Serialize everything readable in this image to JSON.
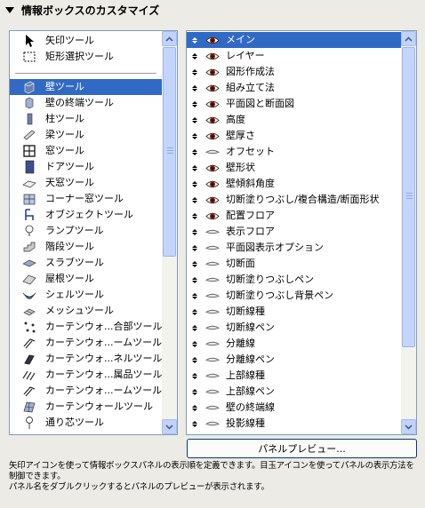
{
  "header": {
    "title": "情報ボックスのカスタマイズ"
  },
  "tools": {
    "top_items": [
      {
        "label": "矢印ツール",
        "icon": "arrow-cursor-icon"
      },
      {
        "label": "矩形選択ツール",
        "icon": "marquee-select-icon"
      }
    ],
    "items": [
      {
        "label": "壁ツール",
        "icon": "wall-icon",
        "selected": true
      },
      {
        "label": "壁の終端ツール",
        "icon": "wall-end-icon"
      },
      {
        "label": "柱ツール",
        "icon": "column-icon"
      },
      {
        "label": "梁ツール",
        "icon": "beam-icon"
      },
      {
        "label": "窓ツール",
        "icon": "window-icon"
      },
      {
        "label": "ドアツール",
        "icon": "door-icon"
      },
      {
        "label": "天窓ツール",
        "icon": "skylight-icon"
      },
      {
        "label": "コーナー窓ツール",
        "icon": "corner-window-icon"
      },
      {
        "label": "オブジェクトツール",
        "icon": "object-chair-icon"
      },
      {
        "label": "ランプツール",
        "icon": "lamp-icon"
      },
      {
        "label": "階段ツール",
        "icon": "stair-icon"
      },
      {
        "label": "スラブツール",
        "icon": "slab-icon"
      },
      {
        "label": "屋根ツール",
        "icon": "roof-icon"
      },
      {
        "label": "シェルツール",
        "icon": "shell-icon"
      },
      {
        "label": "メッシュツール",
        "icon": "mesh-icon"
      },
      {
        "label": "カーテンウォ...合部ツール",
        "icon": "curtain-wall-junction-icon"
      },
      {
        "label": "カーテンウォ...ームツール",
        "icon": "curtain-wall-frame-icon"
      },
      {
        "label": "カーテンウォ...ネルツール",
        "icon": "curtain-wall-panel-icon"
      },
      {
        "label": "カーテンウォ...属品ツール",
        "icon": "curtain-wall-accessory-icon"
      },
      {
        "label": "カーテンウォ...ームツール",
        "icon": "curtain-wall-frame-icon"
      },
      {
        "label": "カーテンウォールツール",
        "icon": "curtain-wall-icon"
      },
      {
        "label": "通り芯ツール",
        "icon": "grid-axis-icon"
      }
    ]
  },
  "properties": {
    "items": [
      {
        "label": "メイン",
        "visible": true,
        "selected": true
      },
      {
        "label": "レイヤー",
        "visible": true
      },
      {
        "label": "図形作成法",
        "visible": true
      },
      {
        "label": "組み立て法",
        "visible": true
      },
      {
        "label": "平面図と断面図",
        "visible": true
      },
      {
        "label": "高度",
        "visible": true
      },
      {
        "label": "壁厚さ",
        "visible": true
      },
      {
        "label": "オフセット",
        "visible": false
      },
      {
        "label": "壁形状",
        "visible": true
      },
      {
        "label": "壁傾斜角度",
        "visible": true
      },
      {
        "label": "切断塗りつぶし/複合構造/断面形状",
        "visible": true
      },
      {
        "label": "配置フロア",
        "visible": true
      },
      {
        "label": "表示フロア",
        "visible": false
      },
      {
        "label": "平面図表示オプション",
        "visible": false
      },
      {
        "label": "切断面",
        "visible": false
      },
      {
        "label": "切断塗りつぶしペン",
        "visible": false
      },
      {
        "label": "切断塗りつぶし背景ペン",
        "visible": false
      },
      {
        "label": "切断線種",
        "visible": false
      },
      {
        "label": "切断線ペン",
        "visible": false
      },
      {
        "label": "分離線",
        "visible": false
      },
      {
        "label": "分離線ペン",
        "visible": false
      },
      {
        "label": "上部線種",
        "visible": false
      },
      {
        "label": "上部線ペン",
        "visible": false
      },
      {
        "label": "壁の終端線",
        "visible": false
      },
      {
        "label": "投影線種",
        "visible": false
      }
    ]
  },
  "preview_button": {
    "label": "パネルプレビュー..."
  },
  "help": {
    "line1": "矢印アイコンを使って情報ボックスパネルの表示順を定義できます。目玉アイコンを使ってパネルの表示方法を",
    "line2": "制御できます。",
    "line3": "パネル名をダブルクリックするとパネルのプレビューが表示されます。"
  },
  "colors": {
    "selection": "#316ac5",
    "eye_iris": "#8a1c00",
    "scrollbar": "#c1d3fb",
    "background": "#ecebe6"
  }
}
